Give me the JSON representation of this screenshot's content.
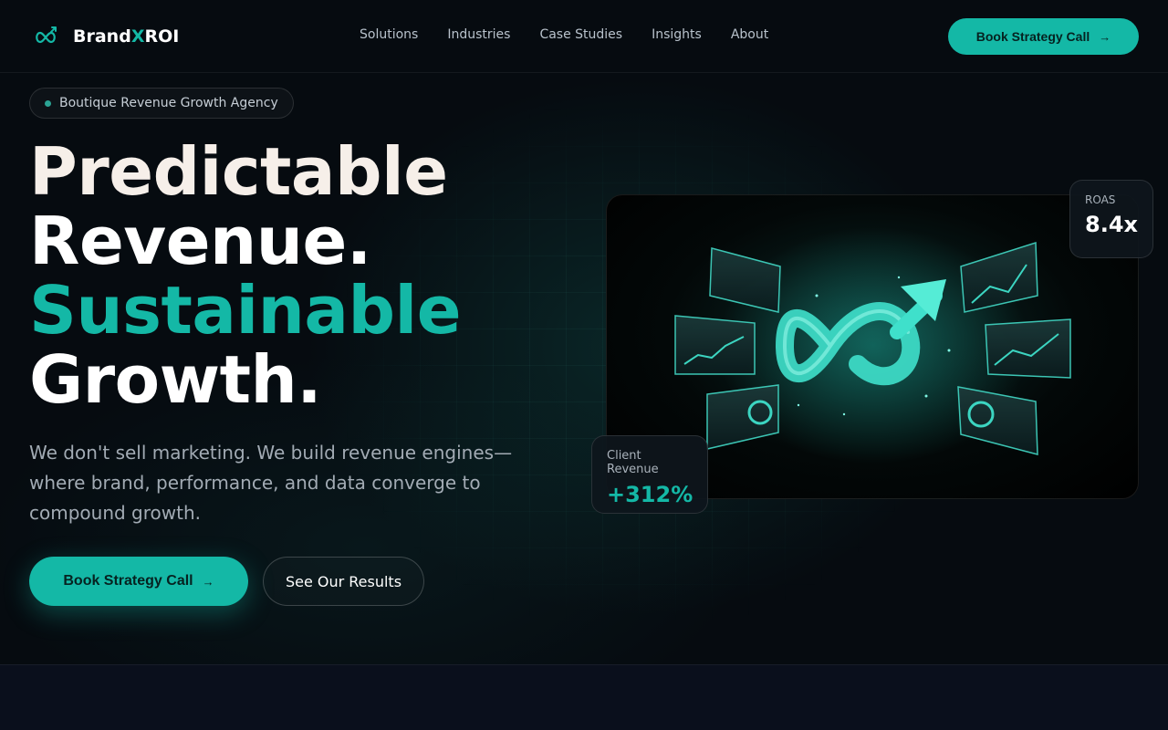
{
  "brand": {
    "name_prefix": "Brand",
    "name_accent": "X",
    "name_suffix": "ROI"
  },
  "nav": {
    "items": [
      {
        "label": "Solutions"
      },
      {
        "label": "Industries"
      },
      {
        "label": "Case Studies"
      },
      {
        "label": "Insights"
      },
      {
        "label": "About"
      }
    ],
    "cta_label": "Book Strategy Call",
    "cta_icon": "arrow-right-icon"
  },
  "hero": {
    "badge": "Boutique Revenue Growth Agency",
    "headline": {
      "line1": "Predictable",
      "line2": "Revenue.",
      "line3": "Sustainable",
      "line4": "Growth."
    },
    "subtext": "We don't sell marketing. We build revenue engines—where brand, performance, and data converge to compound growth.",
    "primary_cta": "Book Strategy Call",
    "secondary_cta": "See Our Results"
  },
  "stats": {
    "roas": {
      "label": "ROAS",
      "value": "8.4x"
    },
    "client_revenue": {
      "label": "Client Revenue",
      "value": "+312%"
    }
  },
  "colors": {
    "accent": "#14b8a6",
    "background": "#060b10",
    "headline_cream": "#f6efe9"
  }
}
